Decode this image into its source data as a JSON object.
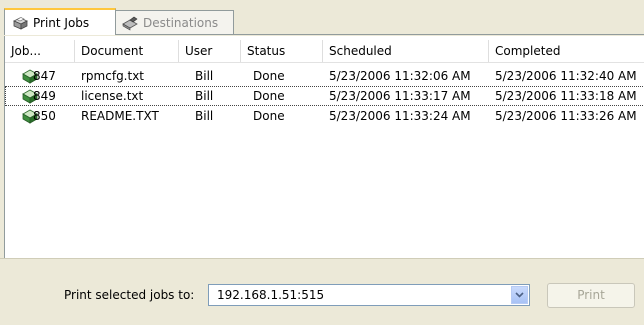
{
  "tabs": [
    {
      "label": "Print Jobs",
      "icon": "printer-icon",
      "active": true
    },
    {
      "label": "Destinations",
      "icon": "destination-printer-icon",
      "active": false
    }
  ],
  "columns": [
    "Job...",
    "Document",
    "User",
    "Status",
    "Scheduled",
    "Completed"
  ],
  "rows": [
    {
      "job": "847",
      "document": "rpmcfg.txt",
      "user": "Bill",
      "status": "Done",
      "scheduled": "5/23/2006 11:32:06 AM",
      "completed": "5/23/2006 11:32:40 AM"
    },
    {
      "job": "849",
      "document": "license.txt",
      "user": "Bill",
      "status": "Done",
      "scheduled": "5/23/2006 11:33:17 AM",
      "completed": "5/23/2006 11:33:18 AM"
    },
    {
      "job": "850",
      "document": "README.TXT",
      "user": "Bill",
      "status": "Done",
      "scheduled": "5/23/2006 11:33:24 AM",
      "completed": "5/23/2006 11:33:26 AM"
    }
  ],
  "bottom": {
    "label": "Print selected jobs to:",
    "destination_value": "192.168.1.51:515",
    "print_label": "Print"
  }
}
